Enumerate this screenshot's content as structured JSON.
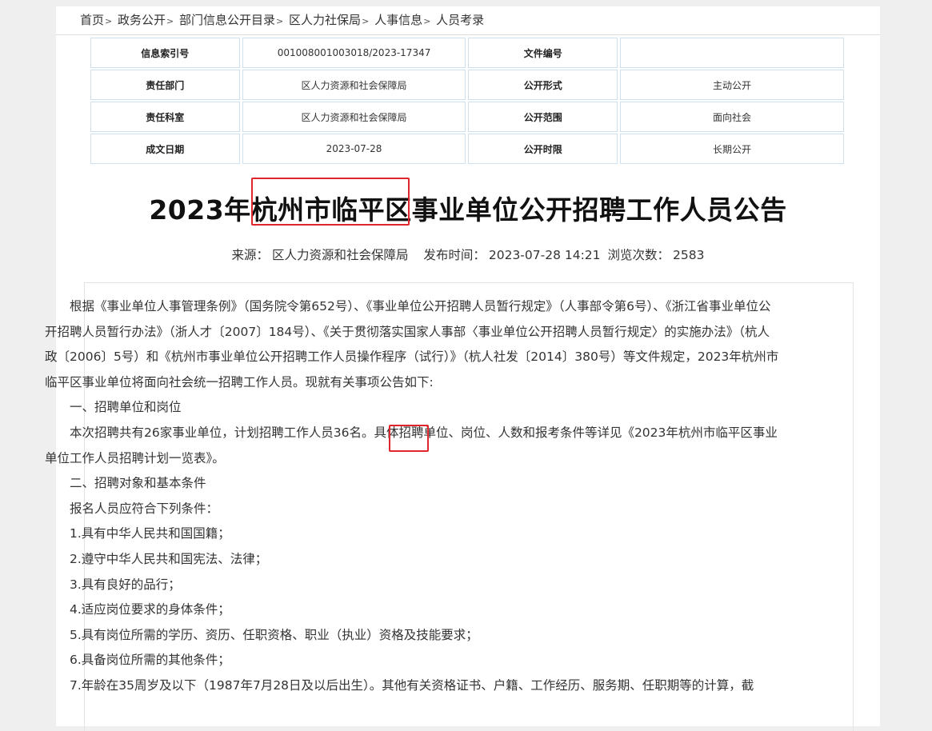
{
  "breadcrumb": [
    "首页",
    "政务公开",
    "部门信息公开目录",
    "区人力社保局",
    "人事信息",
    "人员考录"
  ],
  "meta_table": {
    "rows": [
      [
        "信息索引号",
        "001008001003018/2023-17347",
        "文件编号",
        ""
      ],
      [
        "责任部门",
        "区人力资源和社会保障局",
        "公开形式",
        "主动公开"
      ],
      [
        "责任科室",
        "区人力资源和社会保障局",
        "公开范围",
        "面向社会"
      ],
      [
        "成文日期",
        "2023-07-28",
        "公开时限",
        "长期公开"
      ]
    ]
  },
  "article": {
    "title": "2023年杭州市临平区事业单位公开招聘工作人员公告",
    "source_label": "来源：",
    "source": "区人力资源和社会保障局",
    "publish_label": "发布时间：",
    "publish_time": "2023-07-28 14:21",
    "views_label": "浏览次数：",
    "views": "2583",
    "paragraphs": [
      "根据《事业单位人事管理条例》（国务院令第652号）、《事业单位公开招聘人员暂行规定》（人事部令第6号）、《浙江省事业单位公开招聘人员暂行办法》（浙人才〔2007〕184号）、《关于贯彻落实国家人事部〈事业单位公开招聘人员暂行规定〉的实施办法》（杭人政〔2006〕5号）和《杭州市事业单位公开招聘工作人员操作程序（试行）》（杭人社发〔2014〕380号）等文件规定，2023年杭州市临平区事业单位将面向社会统一招聘工作人员。现就有关事项公告如下:",
      "一、招聘单位和岗位",
      "本次招聘共有26家事业单位，计划招聘工作人员36名。具体招聘单位、岗位、人数和报考条件等详见《2023年杭州市临平区事业单位工作人员招聘计划一览表》。",
      "二、招聘对象和基本条件",
      "报名人员应符合下列条件：",
      "1.具有中华人民共和国国籍；",
      "2.遵守中华人民共和国宪法、法律；",
      "3.具有良好的品行；",
      "4.适应岗位要求的身体条件；",
      "5.具有岗位所需的学历、资历、任职资格、职业（执业）资格及技能要求；",
      "6.具备岗位所需的其他条件；",
      "7.年龄在35周岁及以下（1987年7月28日及以后出生）。其他有关资格证书、户籍、工作经历、服务期、任职期等的计算，截"
    ]
  },
  "colors": {
    "highlight": "#e0262a",
    "table_border": "#cfe0ef"
  }
}
